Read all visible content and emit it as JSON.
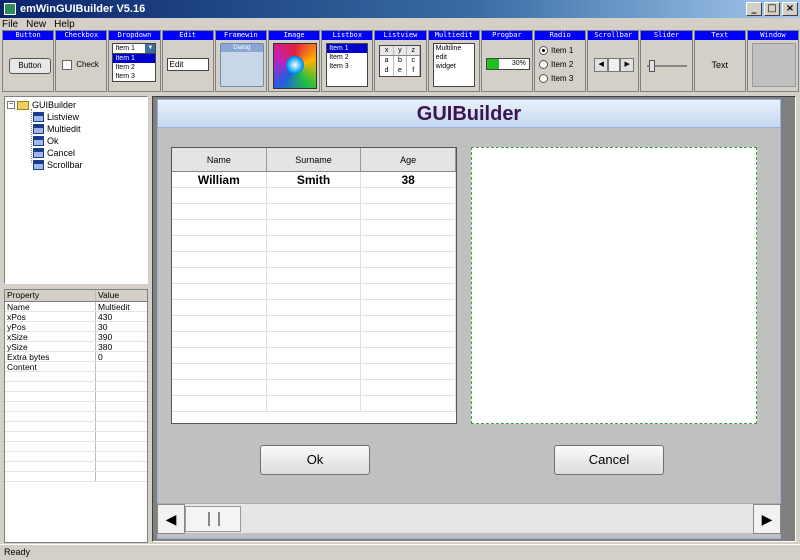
{
  "window": {
    "title": "emWinGUIBuilder V5.16",
    "min_glyph": "_",
    "max_glyph": "□",
    "close_glyph": "×"
  },
  "menu": [
    "File",
    "New",
    "Help"
  ],
  "toolbox": {
    "button": {
      "header": "Button",
      "label": "Button"
    },
    "checkbox": {
      "header": "Checkbox",
      "label": "Check"
    },
    "dropdown": {
      "header": "Dropdown",
      "selected": "Item 1",
      "items": [
        "Item 1",
        "Item 2",
        "Item 3"
      ]
    },
    "edit": {
      "header": "Edit",
      "value": "Edit"
    },
    "framewin": {
      "header": "Framewin",
      "caption": "Dialog"
    },
    "image": {
      "header": "Image"
    },
    "listbox": {
      "header": "Listbox",
      "items": [
        "Item 1",
        "Item 2",
        "Item 3"
      ]
    },
    "listview": {
      "header": "Listview",
      "columns": [
        "x",
        "y",
        "z"
      ],
      "rows": [
        [
          "a",
          "b",
          "c"
        ],
        [
          "d",
          "e",
          "f"
        ]
      ]
    },
    "multiedit": {
      "header": "Multiedit",
      "lines": [
        "Multiline",
        "edit",
        "widget"
      ]
    },
    "progbar": {
      "header": "Progbar",
      "text": "30%",
      "progress": 0.3
    },
    "radio": {
      "header": "Radio",
      "items": [
        "Item 1",
        "Item 2",
        "Item 3"
      ],
      "selected_index": 0
    },
    "scrollbar": {
      "header": "Scrollbar"
    },
    "slider": {
      "header": "Slider"
    },
    "text": {
      "header": "Text",
      "label": "Text"
    },
    "window": {
      "header": "Window"
    }
  },
  "tree": {
    "root": "GUIBuilder",
    "children": [
      "Listview",
      "Multiedit",
      "Ok",
      "Cancel",
      "Scrollbar"
    ]
  },
  "properties": {
    "headers": [
      "Property",
      "Value"
    ],
    "rows": [
      [
        "Name",
        "Multiedit"
      ],
      [
        "xPos",
        "430"
      ],
      [
        "yPos",
        "30"
      ],
      [
        "xSize",
        "390"
      ],
      [
        "ySize",
        "380"
      ],
      [
        "Extra bytes",
        "0"
      ],
      [
        "Content",
        ""
      ]
    ]
  },
  "dialog": {
    "title": "GUIBuilder",
    "listview": {
      "columns": [
        "Name",
        "Surname",
        "Age"
      ],
      "rows": [
        [
          "William",
          "Smith",
          "38"
        ]
      ]
    },
    "ok_label": "Ok",
    "cancel_label": "Cancel"
  },
  "status": "Ready",
  "colors": {
    "toolbox_header": "#0000ff",
    "selection": "#0000cc",
    "dialog_title": "#3c1450",
    "progress_fill": "#20c020"
  }
}
